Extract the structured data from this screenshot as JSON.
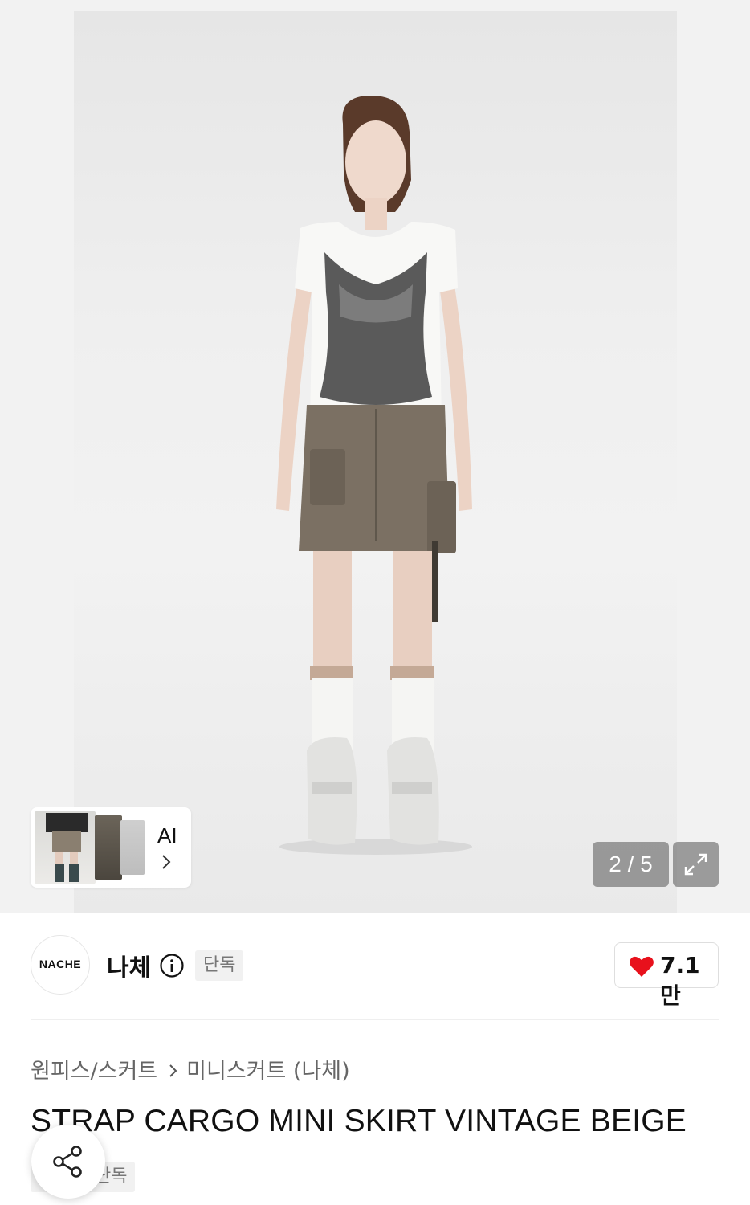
{
  "gallery": {
    "counter_text": "2 / 5",
    "ai_label": "AI"
  },
  "brand": {
    "logo_text": "NACHE",
    "name": "나체",
    "badge": "단독"
  },
  "like": {
    "count": "7.1만",
    "color": "#e8111c"
  },
  "breadcrumb": {
    "category": "원피스/스커트",
    "subcategory": "미니스커트 (나체)"
  },
  "product": {
    "title": "STRAP CARGO MINI SKIRT VINTAGE BEIGE",
    "badge": "단독"
  },
  "icons": {
    "ai_chevron": "chevron-right-icon",
    "expand": "expand-icon",
    "info": "info-icon",
    "heart": "heart-icon",
    "breadcrumb_sep": "chevron-right-icon",
    "share": "share-icon"
  }
}
